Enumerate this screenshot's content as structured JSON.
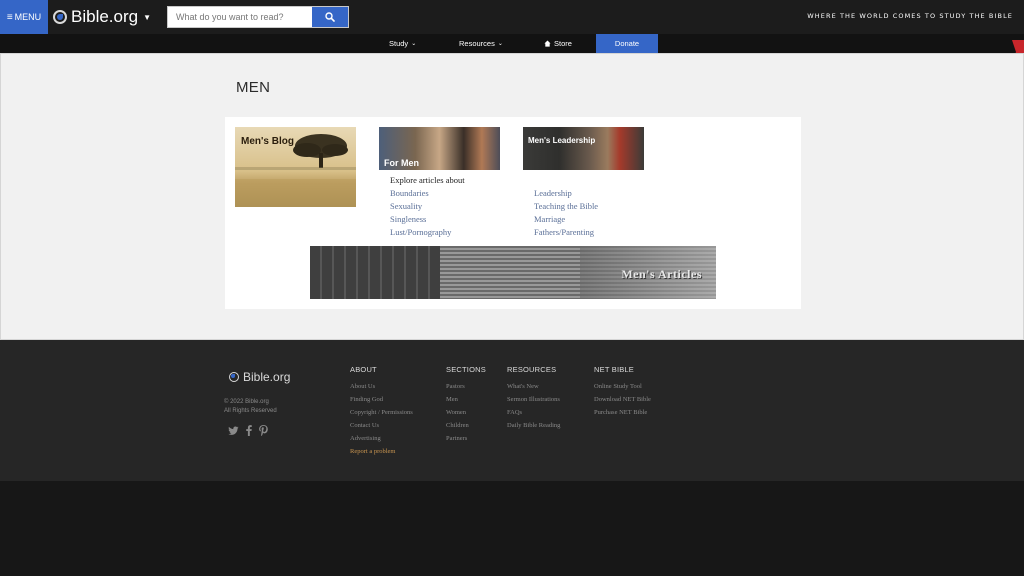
{
  "header": {
    "menu_label": "MENU",
    "logo_text": "Bible.org",
    "search_placeholder": "What do you want to read?",
    "tagline": "WHERE THE WORLD COMES TO STUDY THE BIBLE"
  },
  "nav": {
    "items": [
      {
        "label": "Study",
        "has_dropdown": true
      },
      {
        "label": "Resources",
        "has_dropdown": true
      },
      {
        "label": "Store",
        "icon": "home-icon"
      }
    ],
    "donate_label": "Donate"
  },
  "main": {
    "title": "MEN",
    "blog_thumb_label": "Men's Blog",
    "formen_thumb_label": "For Men",
    "leadership_thumb_label": "Men's Leadership",
    "col2_intro": "Explore articles about",
    "col2_links": [
      "Boundaries",
      "Sexuality",
      "Singleness",
      "Lust/Pornography"
    ],
    "col3_links": [
      "Leadership",
      "Teaching the Bible",
      "Marriage",
      "Fathers/Parenting"
    ],
    "banner_label": "Men's Articles"
  },
  "footer": {
    "logo_text": "Bible.org",
    "copyright": "© 2022 Bible.org",
    "rights": "All Rights Reserved",
    "social_icons": [
      "twitter-icon",
      "facebook-icon",
      "pinterest-icon"
    ],
    "columns": {
      "about": {
        "heading": "ABOUT",
        "links": [
          "About Us",
          "Finding God",
          "Copyright / Permissions",
          "Contact Us",
          "Advertising"
        ],
        "accent_link": "Report a problem"
      },
      "sections": {
        "heading": "SECTIONS",
        "links": [
          "Pastors",
          "Men",
          "Women",
          "Children",
          "Partners"
        ]
      },
      "resources": {
        "heading": "RESOURCES",
        "links": [
          "What's New",
          "Sermon Illustrations",
          "FAQs",
          "Daily Bible Reading"
        ]
      },
      "net_bible": {
        "heading": "NET BIBLE",
        "links": [
          "Online Study Tool",
          "Download NET Bible",
          "Purchase NET Bible"
        ]
      }
    }
  },
  "colors": {
    "accent_blue": "#3566c7",
    "link_blue": "#5a6f97",
    "footer_accent": "#c99550",
    "header_bg": "#1c1c1c",
    "footer_bg": "#262626"
  }
}
